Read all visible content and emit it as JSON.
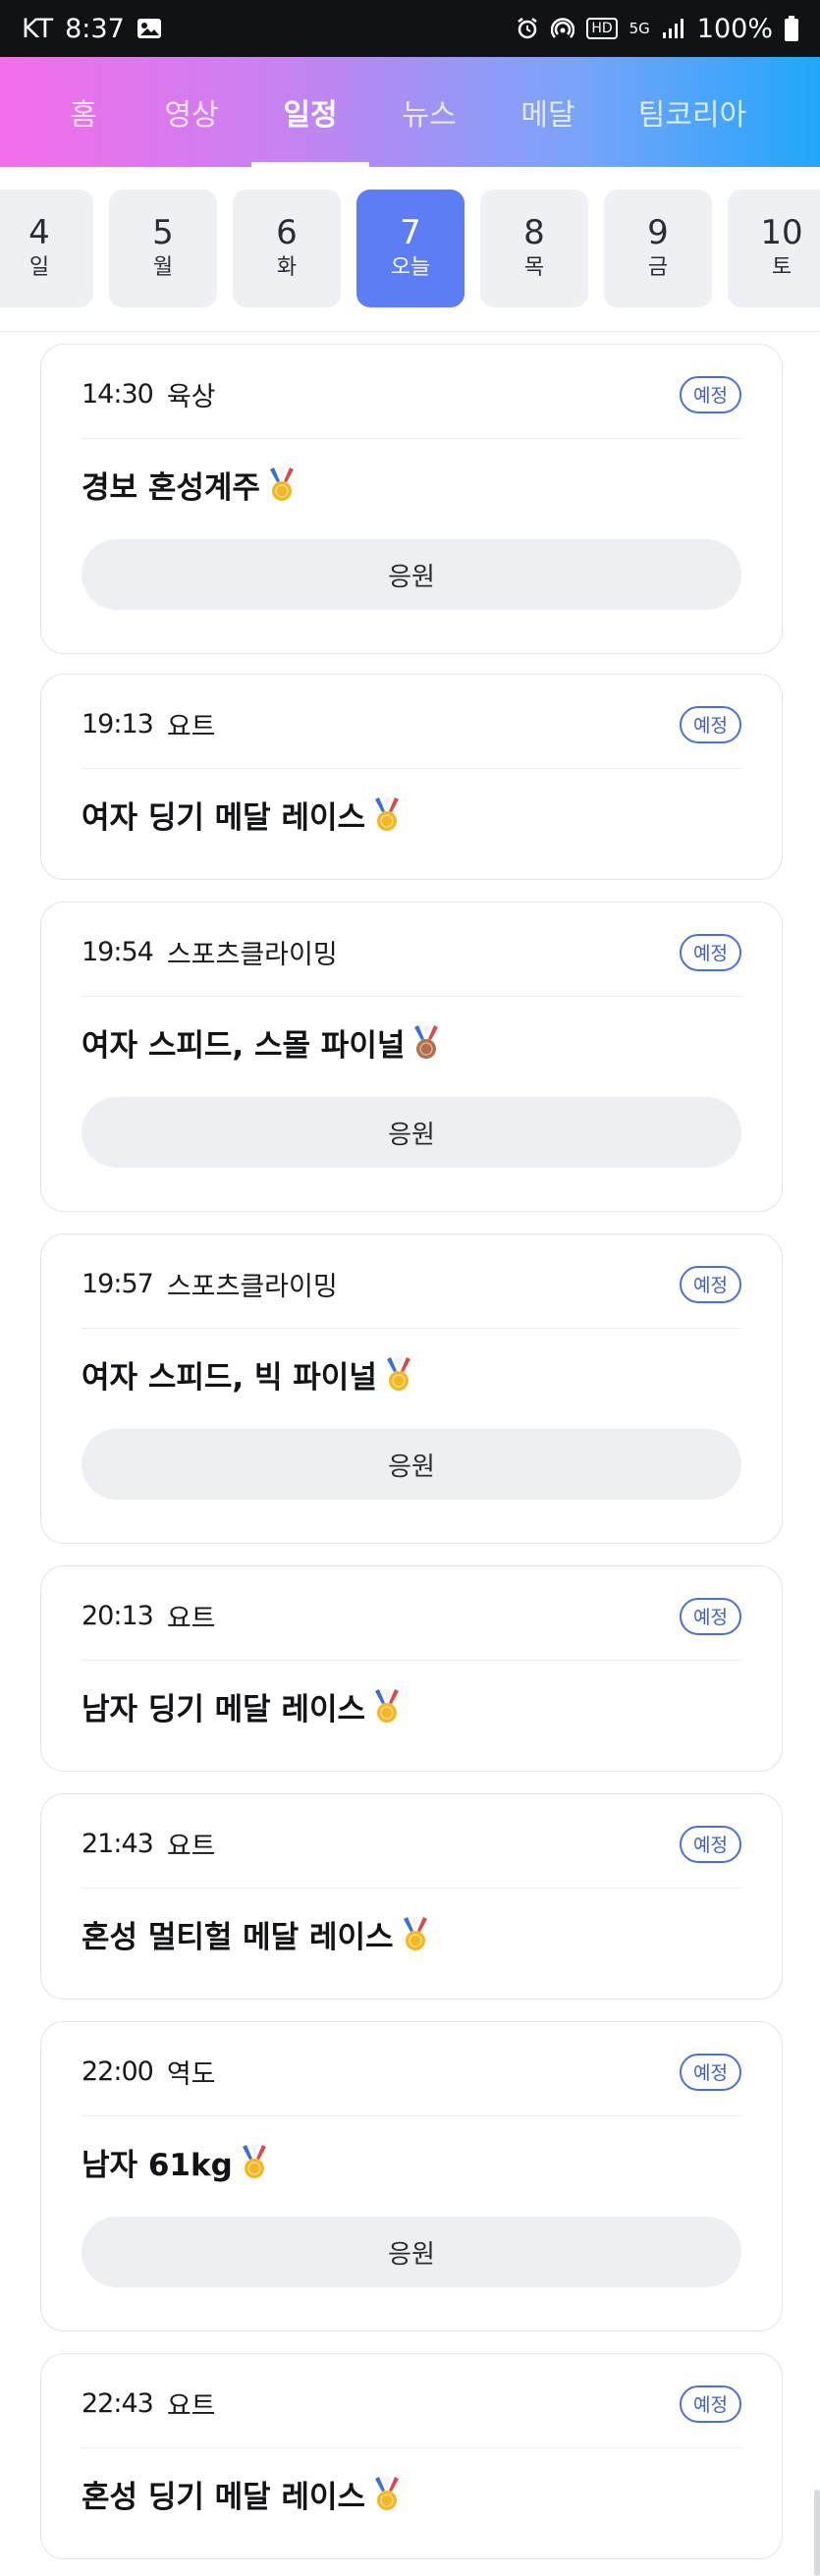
{
  "status_bar": {
    "carrier": "KT",
    "time": "8:37",
    "network": "5G",
    "battery": "100%",
    "icons": [
      "image-icon",
      "alarm-icon",
      "hotspot-icon",
      "hd-voice-icon",
      "5g-icon",
      "signal-icon",
      "battery-icon"
    ]
  },
  "nav": {
    "tabs": [
      "홈",
      "영상",
      "일정",
      "뉴스",
      "메달",
      "팀코리아"
    ],
    "active_index": 2
  },
  "dates": [
    {
      "num": "4",
      "day": "일"
    },
    {
      "num": "5",
      "day": "월"
    },
    {
      "num": "6",
      "day": "화"
    },
    {
      "num": "7",
      "day": "오늘"
    },
    {
      "num": "8",
      "day": "목"
    },
    {
      "num": "9",
      "day": "금"
    },
    {
      "num": "10",
      "day": "토"
    }
  ],
  "active_date_index": 3,
  "events": [
    {
      "time": "14:30",
      "sport": "육상",
      "status": "예정",
      "title": "경보 혼성계주",
      "medal": "gold",
      "cheer_label": "응원"
    },
    {
      "time": "19:13",
      "sport": "요트",
      "status": "예정",
      "title": "여자 딩기 메달 레이스",
      "medal": "gold",
      "cheer_label": ""
    },
    {
      "time": "19:54",
      "sport": "스포츠클라이밍",
      "status": "예정",
      "title": "여자 스피드, 스몰 파이널",
      "medal": "bronze",
      "cheer_label": "응원"
    },
    {
      "time": "19:57",
      "sport": "스포츠클라이밍",
      "status": "예정",
      "title": "여자 스피드, 빅 파이널",
      "medal": "gold",
      "cheer_label": "응원"
    },
    {
      "time": "20:13",
      "sport": "요트",
      "status": "예정",
      "title": "남자 딩기 메달 레이스",
      "medal": "gold",
      "cheer_label": ""
    },
    {
      "time": "21:43",
      "sport": "요트",
      "status": "예정",
      "title": "혼성 멀티헐 메달 레이스",
      "medal": "gold",
      "cheer_label": ""
    },
    {
      "time": "22:00",
      "sport": "역도",
      "status": "예정",
      "title": "남자 61kg",
      "medal": "gold",
      "cheer_label": "응원"
    },
    {
      "time": "22:43",
      "sport": "요트",
      "status": "예정",
      "title": "혼성 딩기 메달 레이스",
      "medal": "gold",
      "cheer_label": ""
    }
  ],
  "colors": {
    "accent": "#5d7df4",
    "badge": "#4e6fd6",
    "gold_medal": "#f2b824",
    "bronze_medal": "#b0714a"
  }
}
